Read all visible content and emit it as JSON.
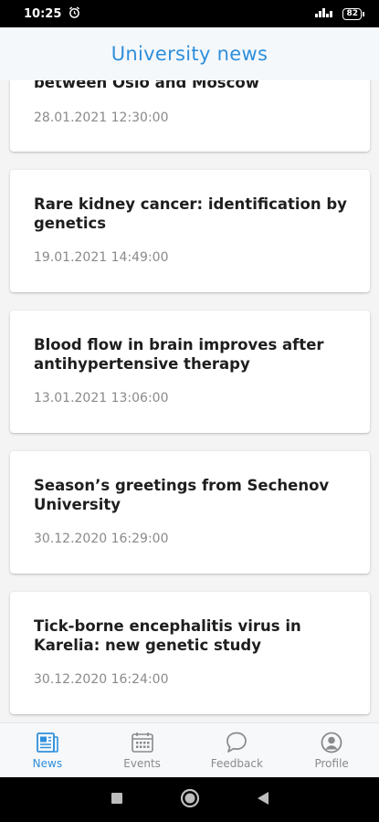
{
  "status_bar": {
    "time": "10:25",
    "alarm_icon": "alarm-icon",
    "signal_icon": "signal-icon",
    "battery_text": "82"
  },
  "header": {
    "title": "University news"
  },
  "news": [
    {
      "title": "between Oslo and Moscow",
      "date": "28.01.2021 12:30:00"
    },
    {
      "title": "Rare kidney cancer: identification by genetics",
      "date": "19.01.2021 14:49:00"
    },
    {
      "title": "Blood flow in brain improves after antihypertensive therapy",
      "date": "13.01.2021 13:06:00"
    },
    {
      "title": "Season’s greetings from Sechenov University",
      "date": "30.12.2020 16:29:00"
    },
    {
      "title": "Tick-borne encephalitis virus in Karelia: new genetic study",
      "date": "30.12.2020 16:24:00"
    }
  ],
  "bottom_nav": {
    "items": [
      {
        "label": "News",
        "icon": "newspaper-icon",
        "active": true
      },
      {
        "label": "Events",
        "icon": "calendar-icon",
        "active": false
      },
      {
        "label": "Feedback",
        "icon": "chat-bubble-icon",
        "active": false
      },
      {
        "label": "Profile",
        "icon": "user-circle-icon",
        "active": false
      }
    ]
  },
  "system_nav": {
    "icons": [
      "recents-square-icon",
      "home-circle-icon",
      "back-triangle-icon"
    ]
  },
  "colors": {
    "accent": "#2f8fdc",
    "header_bg": "#f5f8fb",
    "card_bg": "#ffffff",
    "page_bg": "#f4f4f4"
  }
}
